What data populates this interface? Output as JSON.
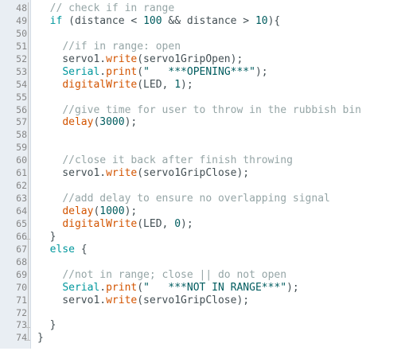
{
  "editor": {
    "lines": [
      {
        "no": "48",
        "tokens": [
          {
            "t": "  "
          },
          {
            "t": "// check if in range",
            "c": "comment"
          }
        ]
      },
      {
        "no": "49",
        "tokens": [
          {
            "t": "  "
          },
          {
            "t": "if",
            "c": "kw"
          },
          {
            "t": " (distance < "
          },
          {
            "t": "100",
            "c": "num"
          },
          {
            "t": " && distance > "
          },
          {
            "t": "10",
            "c": "num"
          },
          {
            "t": "){"
          }
        ]
      },
      {
        "no": "50",
        "tokens": []
      },
      {
        "no": "51",
        "tokens": [
          {
            "t": "    "
          },
          {
            "t": "//if in range: open",
            "c": "comment"
          }
        ]
      },
      {
        "no": "52",
        "tokens": [
          {
            "t": "    servo1."
          },
          {
            "t": "write",
            "c": "fn"
          },
          {
            "t": "(servo1GripOpen);"
          }
        ]
      },
      {
        "no": "53",
        "tokens": [
          {
            "t": "    "
          },
          {
            "t": "Serial",
            "c": "kw"
          },
          {
            "t": "."
          },
          {
            "t": "print",
            "c": "fn"
          },
          {
            "t": "("
          },
          {
            "t": "\"   ***OPENING***\"",
            "c": "str"
          },
          {
            "t": ");"
          }
        ]
      },
      {
        "no": "54",
        "tokens": [
          {
            "t": "    "
          },
          {
            "t": "digitalWrite",
            "c": "fn"
          },
          {
            "t": "(LED, "
          },
          {
            "t": "1",
            "c": "num"
          },
          {
            "t": ");"
          }
        ]
      },
      {
        "no": "55",
        "tokens": []
      },
      {
        "no": "56",
        "tokens": [
          {
            "t": "    "
          },
          {
            "t": "//give time for user to throw in the rubbish bin",
            "c": "comment"
          }
        ]
      },
      {
        "no": "57",
        "tokens": [
          {
            "t": "    "
          },
          {
            "t": "delay",
            "c": "fn"
          },
          {
            "t": "("
          },
          {
            "t": "3000",
            "c": "num"
          },
          {
            "t": ");"
          }
        ]
      },
      {
        "no": "58",
        "tokens": []
      },
      {
        "no": "59",
        "tokens": []
      },
      {
        "no": "60",
        "tokens": [
          {
            "t": "    "
          },
          {
            "t": "//close it back after finish throwing",
            "c": "comment"
          }
        ]
      },
      {
        "no": "61",
        "tokens": [
          {
            "t": "    servo1."
          },
          {
            "t": "write",
            "c": "fn"
          },
          {
            "t": "(servo1GripClose);"
          }
        ]
      },
      {
        "no": "62",
        "tokens": []
      },
      {
        "no": "63",
        "tokens": [
          {
            "t": "    "
          },
          {
            "t": "//add delay to ensure no overlapping signal",
            "c": "comment"
          }
        ]
      },
      {
        "no": "64",
        "tokens": [
          {
            "t": "    "
          },
          {
            "t": "delay",
            "c": "fn"
          },
          {
            "t": "("
          },
          {
            "t": "1000",
            "c": "num"
          },
          {
            "t": ");"
          }
        ]
      },
      {
        "no": "65",
        "tokens": [
          {
            "t": "    "
          },
          {
            "t": "digitalWrite",
            "c": "fn"
          },
          {
            "t": "(LED, "
          },
          {
            "t": "0",
            "c": "num"
          },
          {
            "t": ");"
          }
        ]
      },
      {
        "no": "66",
        "tokens": [
          {
            "t": "  }"
          }
        ]
      },
      {
        "no": "67",
        "tokens": [
          {
            "t": "  "
          },
          {
            "t": "else",
            "c": "kw"
          },
          {
            "t": " {"
          }
        ]
      },
      {
        "no": "68",
        "tokens": []
      },
      {
        "no": "69",
        "tokens": [
          {
            "t": "    "
          },
          {
            "t": "//not in range; close || do not open",
            "c": "comment"
          }
        ]
      },
      {
        "no": "70",
        "tokens": [
          {
            "t": "    "
          },
          {
            "t": "Serial",
            "c": "kw"
          },
          {
            "t": "."
          },
          {
            "t": "print",
            "c": "fn"
          },
          {
            "t": "("
          },
          {
            "t": "\"   ***NOT IN RANGE***\"",
            "c": "str"
          },
          {
            "t": ");"
          }
        ]
      },
      {
        "no": "71",
        "tokens": [
          {
            "t": "    servo1."
          },
          {
            "t": "write",
            "c": "fn"
          },
          {
            "t": "(servo1GripClose);"
          }
        ]
      },
      {
        "no": "72",
        "tokens": []
      },
      {
        "no": "73",
        "tokens": [
          {
            "t": "  }"
          }
        ]
      },
      {
        "no": "74",
        "tokens": [
          {
            "t": "}"
          }
        ]
      }
    ]
  },
  "colors": {
    "gutter_bg": "#e9eef3",
    "comment": "#95a5a6",
    "keyword": "#00979d",
    "function": "#d35400",
    "number": "#005c5f",
    "text": "#434f54"
  }
}
